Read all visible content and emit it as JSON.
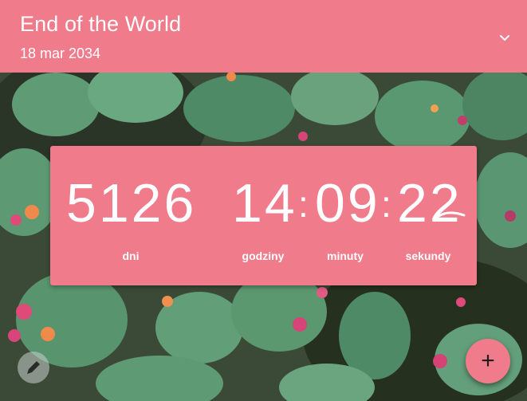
{
  "header": {
    "title": "End of the World",
    "date": "18 mar 2034",
    "expand_icon": "chevron-down-icon",
    "background_color": "#ef7b8b"
  },
  "background": {
    "image": "cactus-garden-photo"
  },
  "countdown": {
    "days": "5126",
    "hours": "14",
    "minutes": "09",
    "seconds": "22",
    "separator": ":",
    "labels": {
      "days": "dni",
      "hours": "godziny",
      "minutes": "minuty",
      "seconds": "sekundy"
    },
    "card_color": "#ef7b8b"
  },
  "fab": {
    "label": "+",
    "icon": "plus-icon"
  },
  "edit_button": {
    "icon": "pencil-icon"
  }
}
